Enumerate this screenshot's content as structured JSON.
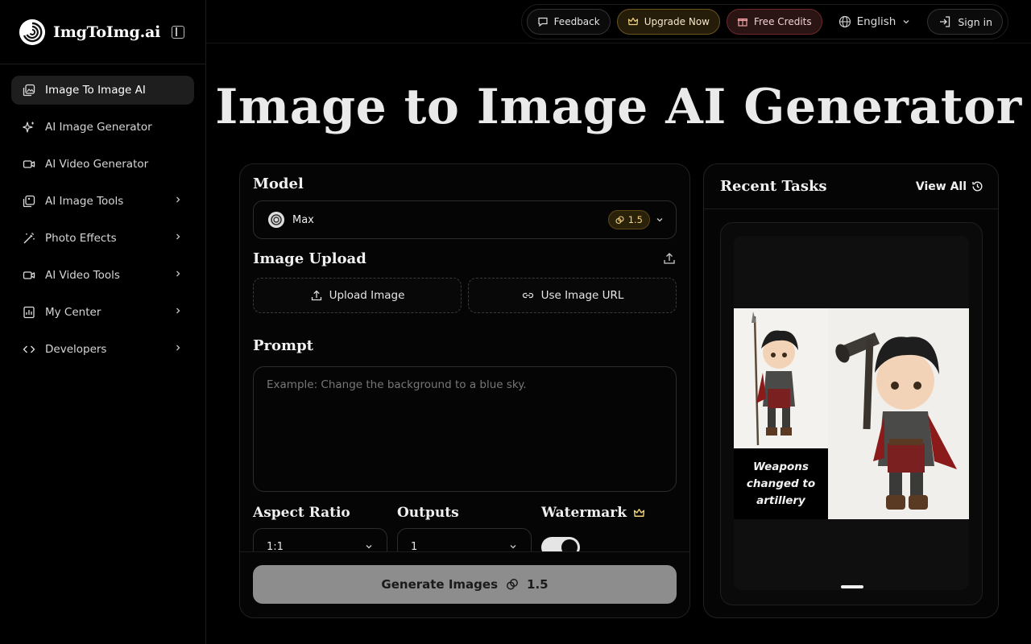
{
  "brand": {
    "name": "ImgToImg.ai"
  },
  "sidebar": {
    "items": [
      {
        "label": "Image To Image AI",
        "icon": "image-edit-icon",
        "active": true,
        "has_chevron": false
      },
      {
        "label": "AI Image Generator",
        "icon": "sparkles-icon",
        "active": false,
        "has_chevron": false
      },
      {
        "label": "AI Video Generator",
        "icon": "video-icon",
        "active": false,
        "has_chevron": false
      },
      {
        "label": "AI Image Tools",
        "icon": "images-icon",
        "active": false,
        "has_chevron": true
      },
      {
        "label": "Photo Effects",
        "icon": "magic-wand-icon",
        "active": false,
        "has_chevron": true
      },
      {
        "label": "AI Video Tools",
        "icon": "video-icon",
        "active": false,
        "has_chevron": true
      },
      {
        "label": "My Center",
        "icon": "dashboard-icon",
        "active": false,
        "has_chevron": true
      },
      {
        "label": "Developers",
        "icon": "code-icon",
        "active": false,
        "has_chevron": true
      }
    ]
  },
  "topbar": {
    "feedback": "Feedback",
    "upgrade": "Upgrade Now",
    "credits": "Free Credits",
    "language": "English",
    "signin": "Sign in"
  },
  "page": {
    "title": "Image to Image AI Generator"
  },
  "form": {
    "model_label": "Model",
    "model_value": "Max",
    "model_cost": "1.5",
    "upload_label": "Image Upload",
    "upload_button": "Upload Image",
    "url_button": "Use Image URL",
    "prompt_label": "Prompt",
    "prompt_placeholder": "Example: Change the background to a blue sky.",
    "aspect_label": "Aspect Ratio",
    "aspect_value": "1:1",
    "outputs_label": "Outputs",
    "outputs_value": "1",
    "watermark_label": "Watermark",
    "watermark_on": true,
    "generate_label": "Generate Images",
    "generate_cost": "1.5"
  },
  "tasks": {
    "title": "Recent Tasks",
    "view_all": "View All",
    "preview_caption": "Weapons changed to artillery"
  },
  "colors": {
    "accent_gold": "#f2d27a",
    "upgrade_bg": "#251c0a",
    "credits_bg": "#2a1414",
    "generate_bg": "#8d8d8d"
  }
}
